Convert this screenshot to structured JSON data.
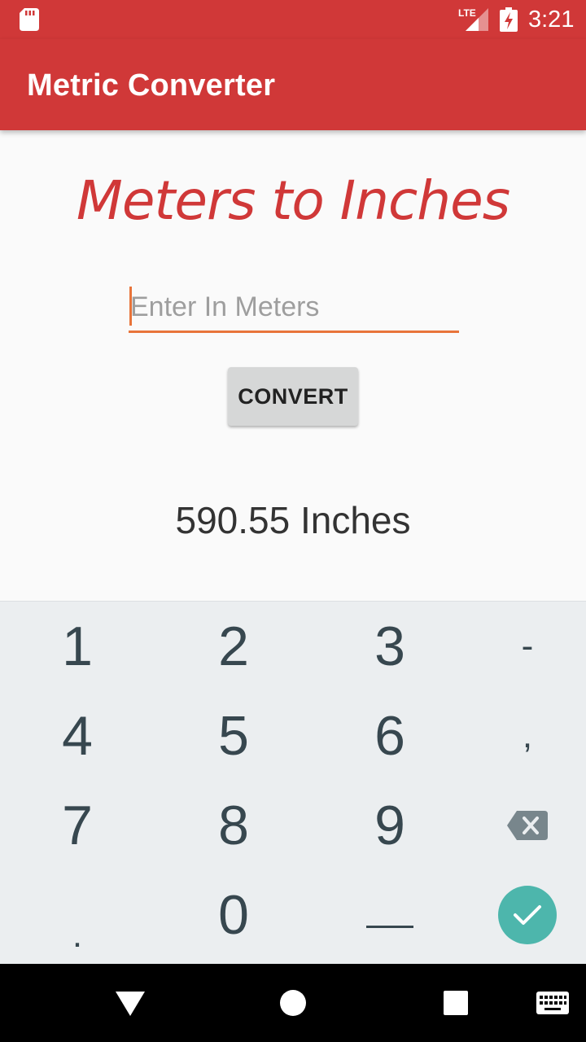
{
  "status_bar": {
    "network_label": "LTE",
    "time": "3:21"
  },
  "app_bar": {
    "title": "Metric Converter"
  },
  "main": {
    "heading": "Meters to Inches",
    "input_placeholder": "Enter In Meters",
    "input_value": "",
    "convert_label": "CONVERT",
    "result_text": "590.55 Inches"
  },
  "keyboard": {
    "keys": [
      "1",
      "2",
      "3",
      "-",
      "4",
      "5",
      "6",
      ",",
      "7",
      "8",
      "9",
      ".",
      "0"
    ],
    "icons": {
      "backspace": "backspace-icon",
      "enter": "check-icon",
      "space": "space-icon"
    }
  },
  "nav_bar": {
    "icons": [
      "back-icon",
      "home-icon",
      "recents-icon",
      "keyboard-icon"
    ]
  },
  "colors": {
    "primary": "#d03838",
    "accent": "#e8743a",
    "enter_key": "#4db6ac",
    "keyboard_bg": "#ebeef0"
  }
}
